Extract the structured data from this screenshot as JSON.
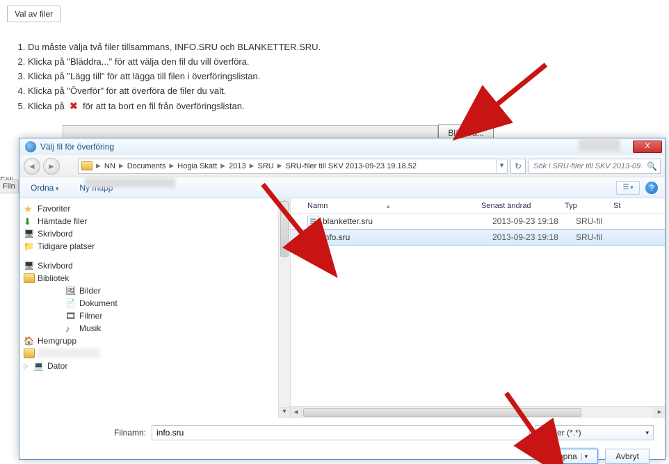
{
  "tab_title": "Val av filer",
  "instructions": [
    "Du måste välja två filer tillsammans, INFO.SRU och BLANKETTER.SRU.",
    "Klicka på \"Bläddra...\" för att välja den fil du vill överföra.",
    "Klicka på \"Lägg till\" för att lägga till filen i överföringslistan.",
    "Klicka på \"Överför\" för att överföra de filer du valt."
  ],
  "instruction5_prefix": "Klicka på",
  "instruction5_suffix": "för att ta bort en fil från överföringslistan.",
  "browse_button": "Bläddra...",
  "left_text": "Följ",
  "left_chip": "Filn",
  "dialog": {
    "title": "Välj fil för överföring",
    "close": "X",
    "breadcrumb": [
      "NN",
      "Documents",
      "Hogia Skatt",
      "2013",
      "SRU",
      "SRU-filer till SKV 2013-09-23 19.18.52"
    ],
    "search_placeholder": "Sök i SRU-filer till SKV 2013-09...",
    "toolbar": {
      "organize": "Ordna",
      "newfolder": "Ny mapp"
    },
    "nav_tree": {
      "favorites": "Favoriter",
      "downloads": "Hämtade filer",
      "desktop": "Skrivbord",
      "recent": "Tidigare platser",
      "desktop2": "Skrivbord",
      "library": "Bibliotek",
      "pictures": "Bilder",
      "documents": "Dokument",
      "films": "Filmer",
      "music": "Musik",
      "homegroup": "Hemgrupp",
      "computer": "Dator"
    },
    "columns": {
      "name": "Namn",
      "modified": "Senast ändrad",
      "type": "Typ",
      "size": "St"
    },
    "files": [
      {
        "name": "blanketter.sru",
        "modified": "2013-09-23 19:18",
        "type": "SRU-fil"
      },
      {
        "name": "info.sru",
        "modified": "2013-09-23 19:18",
        "type": "SRU-fil"
      }
    ],
    "footer": {
      "filename_label": "Filnamn:",
      "filename_value": "info.sru",
      "filter": "lla filer (*.*)",
      "open": "Öppna",
      "cancel": "Avbryt"
    }
  }
}
